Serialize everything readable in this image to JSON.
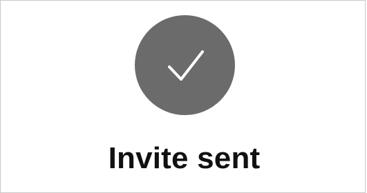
{
  "dialog": {
    "title": "Invite sent",
    "icon": "checkmark-circle-icon"
  },
  "colors": {
    "circle": "#6b6b6b",
    "check": "#ffffff",
    "title": "#111111",
    "border": "#c9c9c9"
  }
}
